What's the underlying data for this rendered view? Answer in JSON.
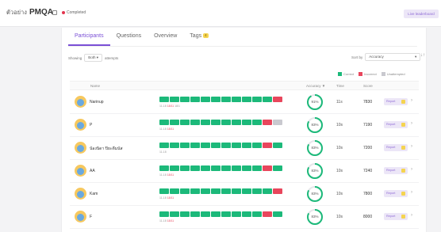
{
  "header": {
    "title_prefix": "ตัวอย่าง",
    "title_main": "PMQA",
    "status_label": "Completed",
    "live_button": "Live leaderboard"
  },
  "tabs": [
    {
      "label": "Participants",
      "active": true
    },
    {
      "label": "Questions",
      "active": false
    },
    {
      "label": "Overview",
      "active": false
    },
    {
      "label": "Tags",
      "badge": "4",
      "active": false
    }
  ],
  "filters": {
    "showing_label": "Showing",
    "showing_value": "Both",
    "attempts_label": "attempts",
    "sort_label": "Sort by",
    "sort_value": "Accuracy",
    "sort_direction": "↓↑"
  },
  "legend": {
    "correct": "Correct",
    "incorrect": "Incorrect",
    "unattempted": "Unattempted",
    "colors": {
      "correct": "#1cb97a",
      "incorrect": "#e8465c",
      "unattempted": "#c9c9cf"
    }
  },
  "table": {
    "headers": {
      "name": "Name",
      "accuracy": "Accuracy ▼",
      "time": "Time",
      "score": "Score"
    },
    "rows": [
      {
        "name": "Narinup",
        "under": "11-18",
        "under_red": "18/11",
        "under_extra": "18/1",
        "segments": "CCCCCCCCCCCI",
        "accuracy": "91%",
        "accuracy_pct": 91,
        "time": "11s",
        "score": "7830",
        "button": "Report"
      },
      {
        "name": "P",
        "under": "11-18",
        "under_red": "18/11",
        "under_extra": "",
        "segments": "CCCCCCCCCCIU",
        "accuracy": "83%",
        "accuracy_pct": 83,
        "time": "10s",
        "score": "7190",
        "button": "Report"
      },
      {
        "name": "น้องนิดา ปิยะดีมนัส",
        "under": "11-18",
        "under_red": "",
        "under_extra": "",
        "segments": "CCCCCCCCCCIC",
        "accuracy": "83%",
        "accuracy_pct": 83,
        "time": "10s",
        "score": "7200",
        "button": "Report"
      },
      {
        "name": "AA",
        "under": "11-18",
        "under_red": "18/11",
        "under_extra": "",
        "segments": "CCCCCCCCCCIC",
        "accuracy": "83%",
        "accuracy_pct": 83,
        "time": "10s",
        "score": "7240",
        "button": "Report"
      },
      {
        "name": "Kam",
        "under": "11-18",
        "under_red": "18/11",
        "under_extra": "",
        "segments": "CCCCCCCCCCCI",
        "accuracy": "83%",
        "accuracy_pct": 83,
        "time": "10s",
        "score": "7800",
        "button": "Report"
      },
      {
        "name": "F",
        "under": "11-18",
        "under_red": "18/11",
        "under_extra": "",
        "segments": "CCCCCCCCCCIC",
        "accuracy": "83%",
        "accuracy_pct": 83,
        "time": "10s",
        "score": "8000",
        "button": "Report"
      }
    ]
  }
}
